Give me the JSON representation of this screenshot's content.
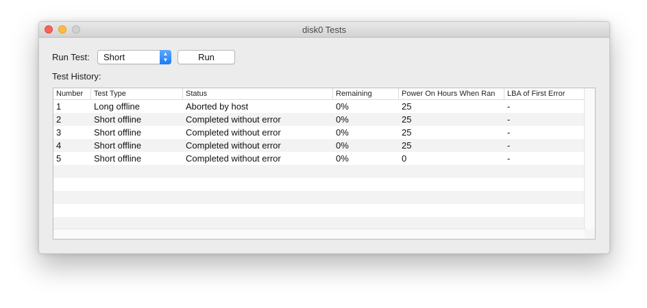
{
  "window": {
    "title": "disk0 Tests"
  },
  "controls": {
    "run_test_label": "Run Test:",
    "test_type_selected": "Short",
    "run_button_label": "Run",
    "history_label": "Test History:"
  },
  "table": {
    "columns": [
      "Number",
      "Test Type",
      "Status",
      "Remaining",
      "Power On Hours When Ran",
      "LBA of First Error"
    ],
    "rows": [
      [
        "1",
        "Long offline",
        "Aborted by host",
        "0%",
        "25",
        "-"
      ],
      [
        "2",
        "Short offline",
        "Completed without error",
        "0%",
        "25",
        "-"
      ],
      [
        "3",
        "Short offline",
        "Completed without error",
        "0%",
        "25",
        "-"
      ],
      [
        "4",
        "Short offline",
        "Completed without error",
        "0%",
        "25",
        "-"
      ],
      [
        "5",
        "Short offline",
        "Completed without error",
        "0%",
        "0",
        "-"
      ]
    ]
  },
  "colors": {
    "close": "#fc605c",
    "minimize": "#fdbc40",
    "zoom_disabled": "#d0d0d0",
    "select_accent": "#1a7cf6",
    "row_stripe": "#f3f3f3"
  },
  "icons": {
    "select_arrows": "updown-chevron-icon"
  }
}
